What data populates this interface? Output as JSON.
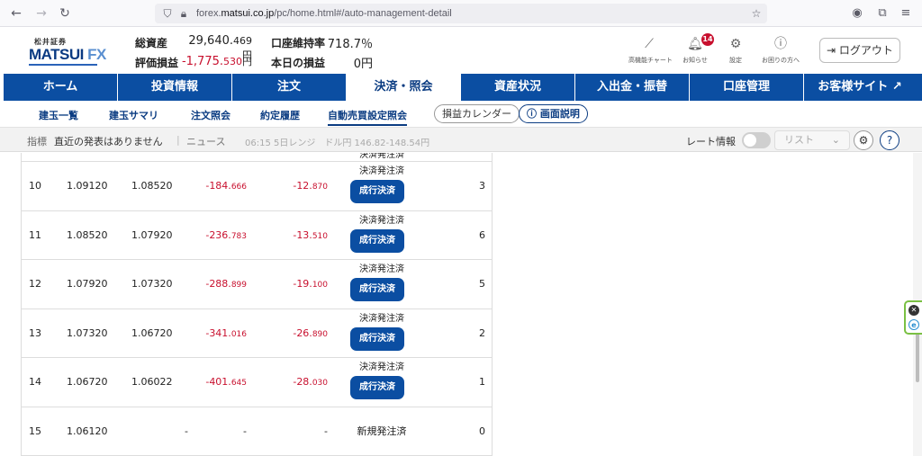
{
  "browser": {
    "url_prefix": "forex.",
    "url_domain": "matsui.co.jp",
    "url_path": "/pc/home.html#/auto-management-detail"
  },
  "header": {
    "logo_top": "松井証券",
    "logo_main": "MATSUI",
    "logo_fx": "FX",
    "total_assets_label": "総資産",
    "total_assets_main": "29,640.",
    "total_assets_decimal": "469",
    "total_assets_unit": "円",
    "margin_ratio_label": "口座維持率",
    "margin_ratio_value": "718.7％",
    "unrealized_label": "評価損益",
    "unrealized_main": "-1,775.",
    "unrealized_decimal": "530",
    "unrealized_unit": "円",
    "today_pl_label": "本日の損益",
    "today_pl_value": "0円",
    "icons": [
      {
        "label": "高機能チャート",
        "icon": "chart-icon"
      },
      {
        "label": "お知らせ",
        "icon": "bell-icon"
      },
      {
        "label": "設定",
        "icon": "gear-icon"
      },
      {
        "label": "お困りの方へ",
        "icon": "help-icon"
      }
    ],
    "notification_count": "14",
    "logout_label": "ログアウト"
  },
  "main_nav": [
    {
      "label": "ホーム"
    },
    {
      "label": "投資情報"
    },
    {
      "label": "注文"
    },
    {
      "label": "決済・照会"
    },
    {
      "label": "資産状況"
    },
    {
      "label": "入出金・振替"
    },
    {
      "label": "口座管理"
    },
    {
      "label": "お客様サイト"
    }
  ],
  "sub_nav": [
    {
      "label": "建玉一覧"
    },
    {
      "label": "建玉サマリ"
    },
    {
      "label": "注文照会"
    },
    {
      "label": "約定履歴"
    },
    {
      "label": "自動売買設定照会"
    }
  ],
  "sub_pills": {
    "calendar": "損益カレンダー",
    "help": "画面説明"
  },
  "news_bar": {
    "indicator_label": "指標",
    "indicator_text": "直近の発表はありません",
    "news_label": "ニュース",
    "news_text": "06:15 5日レンジ　ドル円 146.82-148.54円",
    "rate_label": "レート情報",
    "list_label": "リスト"
  },
  "table": {
    "status_ordered": "決済発注済",
    "exec_label": "成行決済",
    "rows": [
      {
        "no": "",
        "p1": "",
        "p2": "",
        "pl1_main": "",
        "pl1_dec": "",
        "pl2_main": "",
        "pl2_dec": "",
        "count": ""
      },
      {
        "no": "10",
        "p1": "1.09120",
        "p2": "1.08520",
        "pl1_main": "-184.",
        "pl1_dec": "666",
        "pl2_main": "-12.",
        "pl2_dec": "870",
        "count": "3"
      },
      {
        "no": "11",
        "p1": "1.08520",
        "p2": "1.07920",
        "pl1_main": "-236.",
        "pl1_dec": "783",
        "pl2_main": "-13.",
        "pl2_dec": "510",
        "count": "6"
      },
      {
        "no": "12",
        "p1": "1.07920",
        "p2": "1.07320",
        "pl1_main": "-288.",
        "pl1_dec": "899",
        "pl2_main": "-19.",
        "pl2_dec": "100",
        "count": "5"
      },
      {
        "no": "13",
        "p1": "1.07320",
        "p2": "1.06720",
        "pl1_main": "-341.",
        "pl1_dec": "016",
        "pl2_main": "-26.",
        "pl2_dec": "890",
        "count": "2"
      },
      {
        "no": "14",
        "p1": "1.06720",
        "p2": "1.06022",
        "pl1_main": "-401.",
        "pl1_dec": "645",
        "pl2_main": "-28.",
        "pl2_dec": "030",
        "count": "1"
      }
    ],
    "last_row": {
      "no": "15",
      "p1": "1.06120",
      "p2": "-",
      "pl1": "-",
      "pl2": "-",
      "status": "新規発注済",
      "count": "0"
    }
  }
}
